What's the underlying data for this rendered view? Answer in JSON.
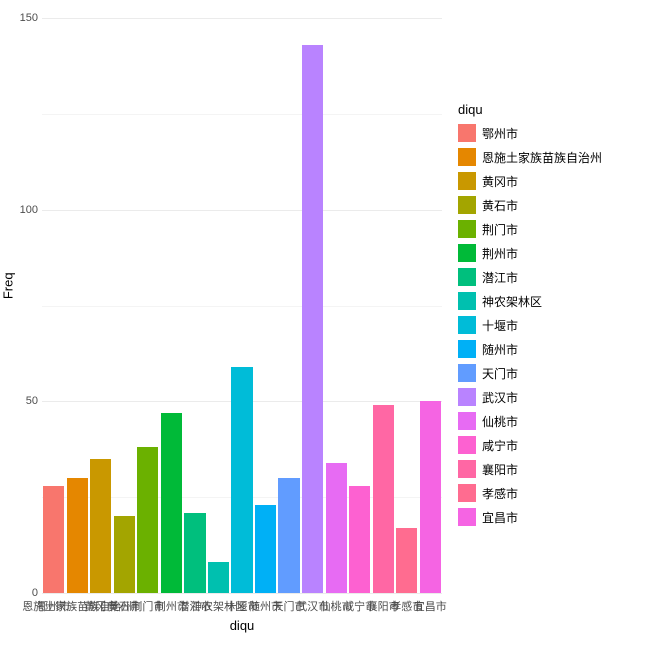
{
  "chart_data": {
    "type": "bar",
    "xlabel": "diqu",
    "ylabel": "Freq",
    "legend_title": "diqu",
    "ylim": [
      0,
      150
    ],
    "yticks": [
      0,
      50,
      100,
      150
    ],
    "categories": [
      "鄂州市",
      "恩施土家族苗族自治州",
      "黄冈市",
      "黄石市",
      "荆门市",
      "荆州市",
      "潜江市",
      "神农架林区",
      "十堰市",
      "随州市",
      "天门市",
      "武汉市",
      "仙桃市",
      "咸宁市",
      "襄阳市",
      "孝感市",
      "宜昌市"
    ],
    "values": [
      28,
      30,
      35,
      20,
      38,
      47,
      21,
      8,
      59,
      23,
      30,
      143,
      34,
      28,
      49,
      17,
      50
    ],
    "colors": [
      "#F8766D",
      "#E58700",
      "#C99800",
      "#A3A500",
      "#6BB100",
      "#00BA38",
      "#00BF7D",
      "#00C0AF",
      "#00BCD8",
      "#00B0F6",
      "#619CFF",
      "#B983FF",
      "#E76BF3",
      "#FD61D1",
      "#FF67A4",
      "#FF6C90",
      "#F564E3"
    ],
    "legend_colors": [
      "#F8766D",
      "#E58700",
      "#C99800",
      "#A3A500",
      "#6BB100",
      "#00BA38",
      "#00BF7D",
      "#00C0AF",
      "#00BCD8",
      "#00B0F6",
      "#619CFF",
      "#B983FF",
      "#E76BF3",
      "#FD61D1",
      "#FF67A4",
      "#FF6C90",
      "#F564E3"
    ]
  }
}
